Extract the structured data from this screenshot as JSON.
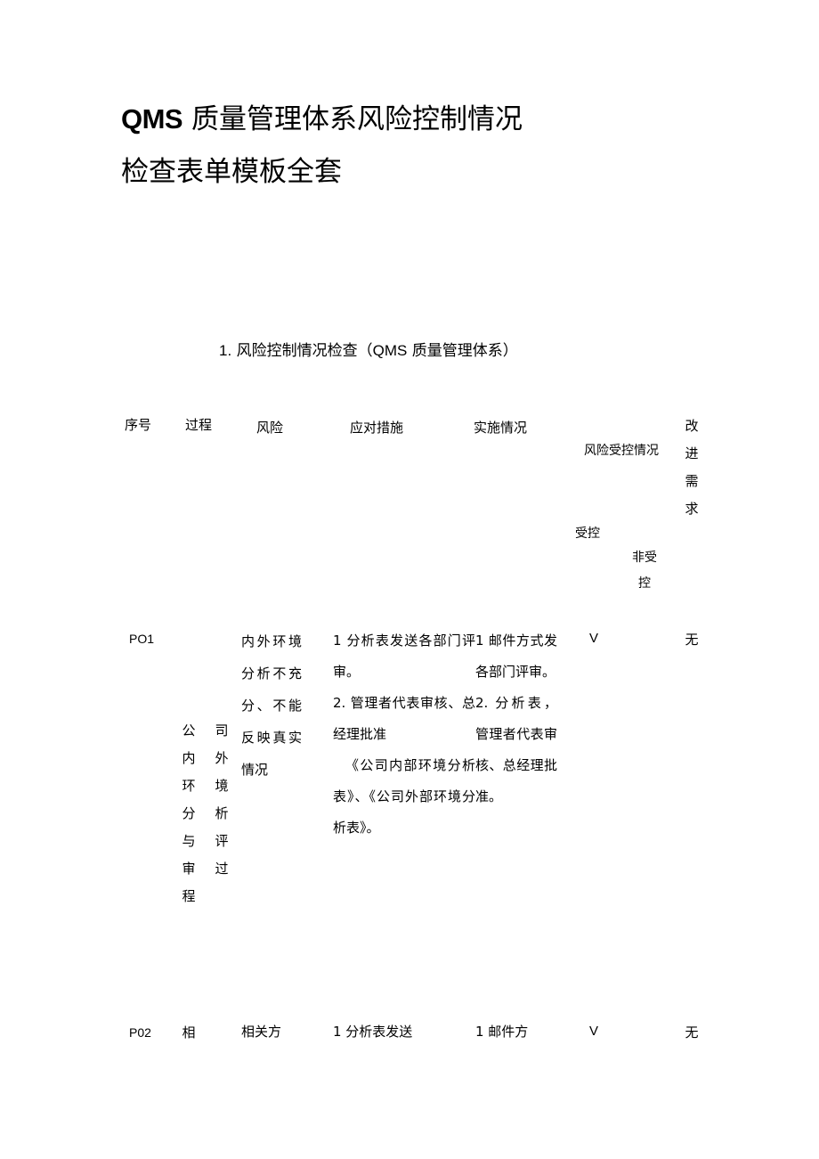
{
  "document": {
    "title_line1_latin": "QMS",
    "title_line1_cn": " 质量管理体系风险控制情况",
    "title_line2": "检查表单模板全套",
    "section_number": "1.",
    "section_title_part1": " 风险控制情况检查（",
    "section_title_latin": "QMS",
    "section_title_part2": " 质量管理体系）"
  },
  "table": {
    "headers": {
      "seq": "序号",
      "process": "过程",
      "risk": "风险",
      "measures": "应对措施",
      "implementation": "实施情况",
      "risk_control_status": "风险受控情况",
      "controlled": "受控",
      "not_controlled": "非受控",
      "improvement_need": "改进需求"
    },
    "rows": [
      {
        "seq": "PO1",
        "process_col_a": "公内环分与审程",
        "process_col_b": "司外境析评过",
        "process_full": "公司内外环境分析与评审过程",
        "risk": "内外环境分析不充分、不能反映真实情况",
        "measures_line1": "1 分析表发送各部门评审。",
        "measures_line2": "2. 管理者代表审核、总经理批准",
        "measures_line3": "《公司内部环境分析表》、《公司外部环境分析表》。",
        "implementation_line1": "1 邮件方式发各部门评审。",
        "implementation_line2": "2. 分析表，管理者代表审核、总经理批准。",
        "controlled_mark": "V",
        "not_controlled_mark": "",
        "improvement_need": "无"
      },
      {
        "seq": "P02",
        "process_col_a": "相",
        "process_col_b": "",
        "process_full": "相",
        "risk": "相关方",
        "measures_line1": "1 分析表发送",
        "measures_line2": "",
        "measures_line3": "",
        "implementation_line1": "1 邮件方",
        "implementation_line2": "",
        "controlled_mark": "V",
        "not_controlled_mark": "",
        "improvement_need": "无"
      }
    ]
  }
}
